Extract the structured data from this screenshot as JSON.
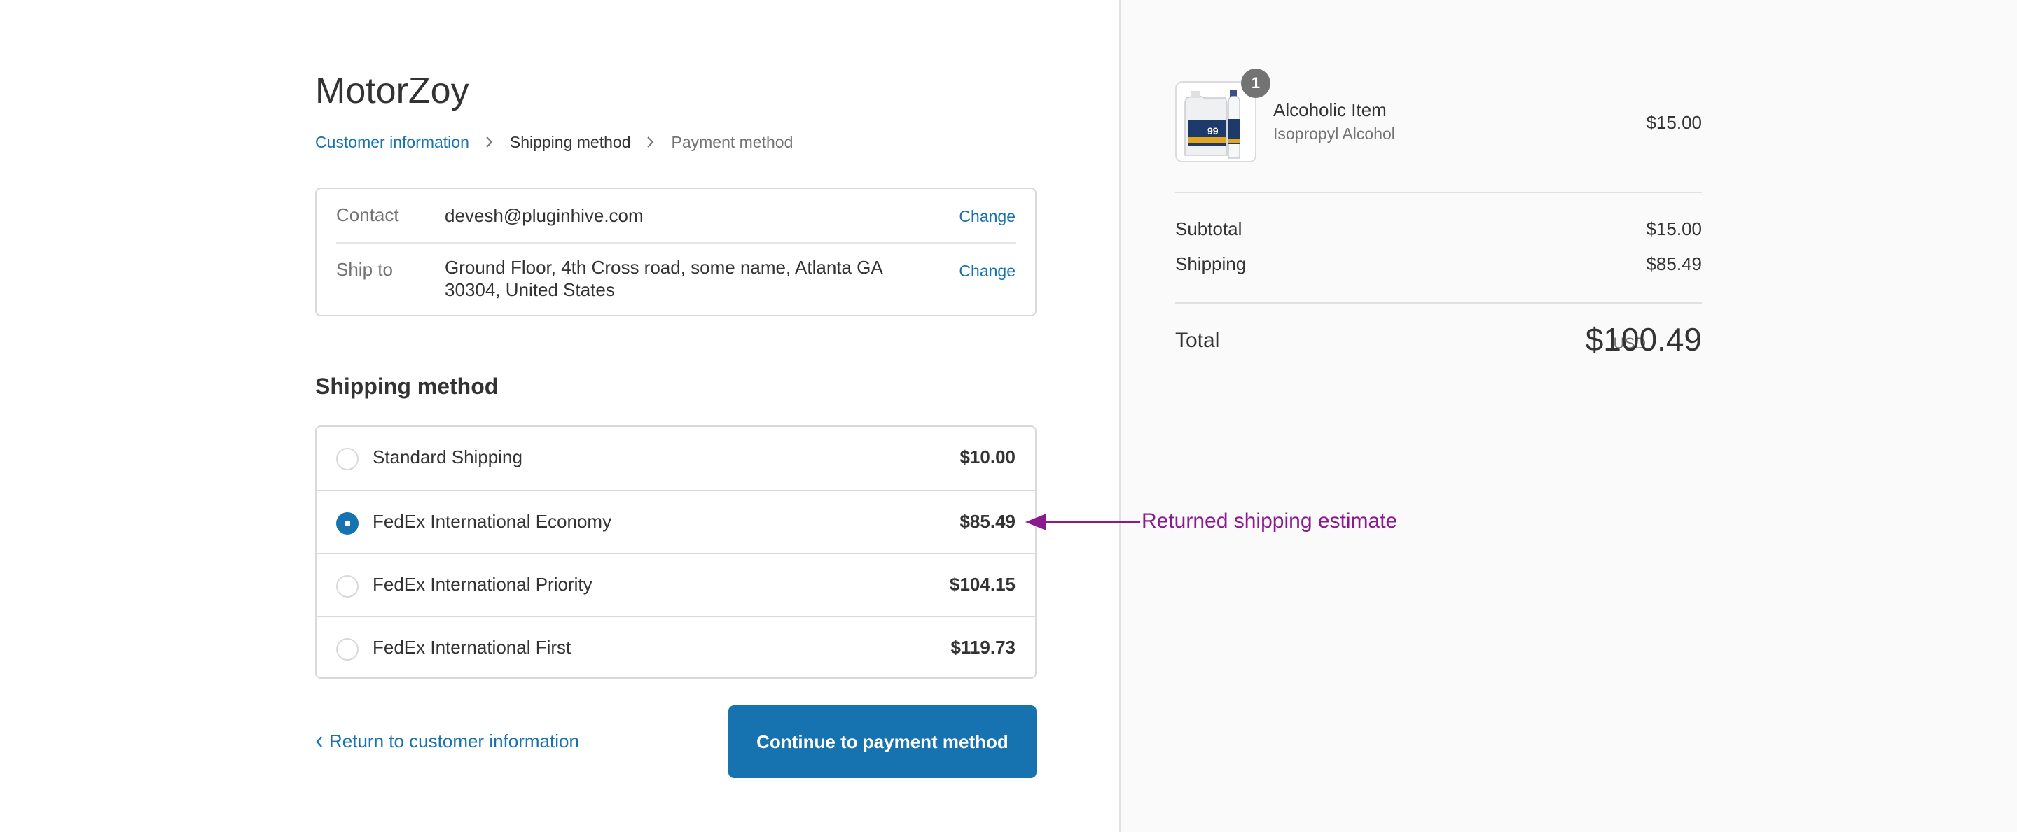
{
  "store": {
    "name": "MotorZoy"
  },
  "breadcrumb": {
    "items": [
      {
        "label": "Customer information",
        "state": "link"
      },
      {
        "label": "Shipping method",
        "state": "current"
      },
      {
        "label": "Payment method",
        "state": "next"
      }
    ]
  },
  "review": {
    "contact": {
      "label": "Contact",
      "value": "devesh@pluginhive.com",
      "change": "Change"
    },
    "ship_to": {
      "label": "Ship to",
      "value": "Ground Floor, 4th Cross road, some name, Atlanta GA 30304, United States",
      "change": "Change"
    }
  },
  "shipping": {
    "title": "Shipping method",
    "methods": [
      {
        "name": "Standard Shipping",
        "price": "$10.00",
        "selected": false
      },
      {
        "name": "FedEx International Economy",
        "price": "$85.49",
        "selected": true
      },
      {
        "name": "FedEx International Priority",
        "price": "$104.15",
        "selected": false
      },
      {
        "name": "FedEx International First",
        "price": "$119.73",
        "selected": false
      }
    ]
  },
  "actions": {
    "return_label": "Return to customer information",
    "continue_label": "Continue to payment method"
  },
  "annotation": {
    "text": "Returned shipping estimate",
    "color": "#8b1a8f"
  },
  "summary": {
    "item": {
      "name": "Alcoholic Item",
      "variant": "Isopropyl Alcohol",
      "price": "$15.00",
      "quantity": "1"
    },
    "subtotal_label": "Subtotal",
    "subtotal": "$15.00",
    "shipping_label": "Shipping",
    "shipping": "$85.49",
    "total_label": "Total",
    "currency": "USD",
    "total": "$100.49"
  },
  "colors": {
    "accent": "#1773b0",
    "text": "#333333",
    "muted": "#737373",
    "border": "#d9d9d9",
    "sidebar_bg": "#fafafa"
  },
  "icons": {
    "breadcrumb_separator": "chevron-right-icon",
    "return_chevron": "chevron-left-icon",
    "product_image": "product-thumbnail-icon"
  }
}
